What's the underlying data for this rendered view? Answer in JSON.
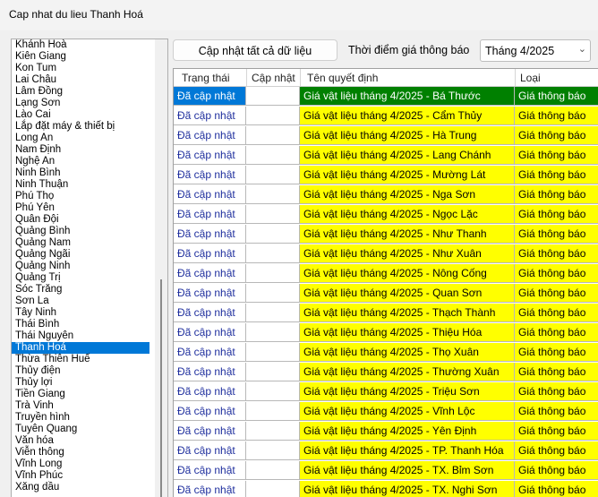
{
  "window": {
    "title": "Cap nhat du lieu Thanh Hoá"
  },
  "list": {
    "selected_index": 27,
    "items": [
      "Khánh Hoà",
      "Kiên Giang",
      "Kon Tum",
      "Lai Châu",
      "Lâm Đồng",
      "Lạng Sơn",
      "Lào Cai",
      "Lắp đặt máy & thiết bị",
      "Long An",
      "Nam Định",
      "Nghệ An",
      "Ninh Bình",
      "Ninh Thuận",
      "Phú Thọ",
      "Phú Yên",
      "Quân Đội",
      "Quảng Bình",
      "Quảng Nam",
      "Quảng Ngãi",
      "Quảng Ninh",
      "Quảng Trị",
      "Sóc Trăng",
      "Sơn La",
      "Tây Ninh",
      "Thái Bình",
      "Thái Nguyên",
      "Thanh Hoá",
      "Thừa Thiên Huế",
      "Thủy điện",
      "Thủy lợi",
      "Tiền Giang",
      "Trà Vinh",
      "Truyền hình",
      "Tuyên Quang",
      "Văn hóa",
      "Viễn thông",
      "Vĩnh Long",
      "Vĩnh Phúc",
      "Xăng dầu"
    ]
  },
  "toolbar": {
    "update_all_label": "Cập nhật tất cả dữ liệu",
    "time_label": "Thời điểm giá thông báo",
    "period_value": "Tháng 4/2025"
  },
  "table": {
    "headers": [
      "Trạng thái",
      "Cập nhật",
      "Tên quyết định",
      "Loại"
    ],
    "rows": [
      {
        "status": "Đã cập nhật",
        "update": "",
        "name": "Giá vật liệu tháng 4/2025 - Bá Thước",
        "type": "Giá thông báo"
      },
      {
        "status": "Đã cập nhật",
        "update": "",
        "name": "Giá vật liệu tháng 4/2025 - Cẩm Thủy",
        "type": "Giá thông báo"
      },
      {
        "status": "Đã cập nhật",
        "update": "",
        "name": "Giá vật liệu tháng 4/2025 - Hà Trung",
        "type": "Giá thông báo"
      },
      {
        "status": "Đã cập nhật",
        "update": "",
        "name": "Giá vật liệu tháng 4/2025 - Lang Chánh",
        "type": "Giá thông báo"
      },
      {
        "status": "Đã cập nhật",
        "update": "",
        "name": "Giá vật liệu tháng 4/2025 - Mường Lát",
        "type": "Giá thông báo"
      },
      {
        "status": "Đã cập nhật",
        "update": "",
        "name": "Giá vật liệu tháng 4/2025 - Nga Sơn",
        "type": "Giá thông báo"
      },
      {
        "status": "Đã cập nhật",
        "update": "",
        "name": "Giá vật liệu tháng 4/2025 - Ngọc Lặc",
        "type": "Giá thông báo"
      },
      {
        "status": "Đã cập nhật",
        "update": "",
        "name": "Giá vật liệu tháng 4/2025 - Như Thanh",
        "type": "Giá thông báo"
      },
      {
        "status": "Đã cập nhật",
        "update": "",
        "name": "Giá vật liệu tháng 4/2025 - Như Xuân",
        "type": "Giá thông báo"
      },
      {
        "status": "Đã cập nhật",
        "update": "",
        "name": "Giá vật liệu tháng 4/2025 - Nông Cống",
        "type": "Giá thông báo"
      },
      {
        "status": "Đã cập nhật",
        "update": "",
        "name": "Giá vật liệu tháng 4/2025 - Quan Sơn",
        "type": "Giá thông báo"
      },
      {
        "status": "Đã cập nhật",
        "update": "",
        "name": "Giá vật liệu tháng 4/2025 - Thạch Thành",
        "type": "Giá thông báo"
      },
      {
        "status": "Đã cập nhật",
        "update": "",
        "name": "Giá vật liệu tháng 4/2025 - Thiệu Hóa",
        "type": "Giá thông báo"
      },
      {
        "status": "Đã cập nhật",
        "update": "",
        "name": "Giá vật liệu tháng 4/2025 - Thọ Xuân",
        "type": "Giá thông báo"
      },
      {
        "status": "Đã cập nhật",
        "update": "",
        "name": "Giá vật liệu tháng 4/2025 - Thường Xuân",
        "type": "Giá thông báo"
      },
      {
        "status": "Đã cập nhật",
        "update": "",
        "name": "Giá vật liệu tháng 4/2025 - Triệu Sơn",
        "type": "Giá thông báo"
      },
      {
        "status": "Đã cập nhật",
        "update": "",
        "name": "Giá vật liệu tháng 4/2025 - Vĩnh Lộc",
        "type": "Giá thông báo"
      },
      {
        "status": "Đã cập nhật",
        "update": "",
        "name": "Giá vật liệu tháng 4/2025 - Yên Định",
        "type": "Giá thông báo"
      },
      {
        "status": "Đã cập nhật",
        "update": "",
        "name": "Giá vật liệu tháng 4/2025 - TP. Thanh Hóa",
        "type": "Giá thông báo"
      },
      {
        "status": "Đã cập nhật",
        "update": "",
        "name": "Giá vật liệu tháng 4/2025 - TX. Bỉm Sơn",
        "type": "Giá thông báo"
      },
      {
        "status": "Đã cập nhật",
        "update": "",
        "name": "Giá vật liệu tháng 4/2025 - TX. Nghi Sơn",
        "type": "Giá thông báo"
      }
    ]
  },
  "colors": {
    "selection": "#0078d7",
    "highlight_row": "#008000",
    "name_cell": "#ffff00",
    "status_text": "#1f2f9e"
  }
}
